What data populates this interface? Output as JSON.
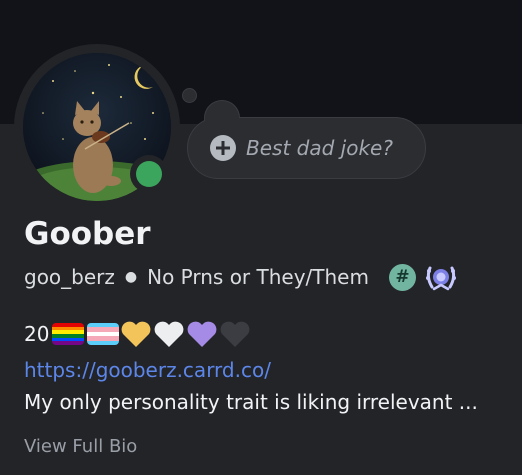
{
  "profile": {
    "display_name": "Goober",
    "username": "goo_berz",
    "pronouns": "No Prns or They/Them",
    "custom_status_placeholder": "Best dad joke?",
    "age_text": "20",
    "link": "https://gooberz.carrd.co/",
    "bio": "My only personality trait is liking irrelevant ...",
    "view_full_bio": "View Full Bio",
    "hash_badge": "#"
  },
  "status": {
    "state": "online",
    "color": "#3ba55d"
  },
  "badges": [
    "hashtag-badge",
    "laurel-badge"
  ],
  "emoji": [
    "rainbow-flag",
    "trans-flag",
    "yellow-heart",
    "white-heart",
    "purple-heart",
    "black-heart"
  ],
  "colors": {
    "accent_link": "#5c86e8",
    "banner": "#121219",
    "card": "#232428"
  }
}
